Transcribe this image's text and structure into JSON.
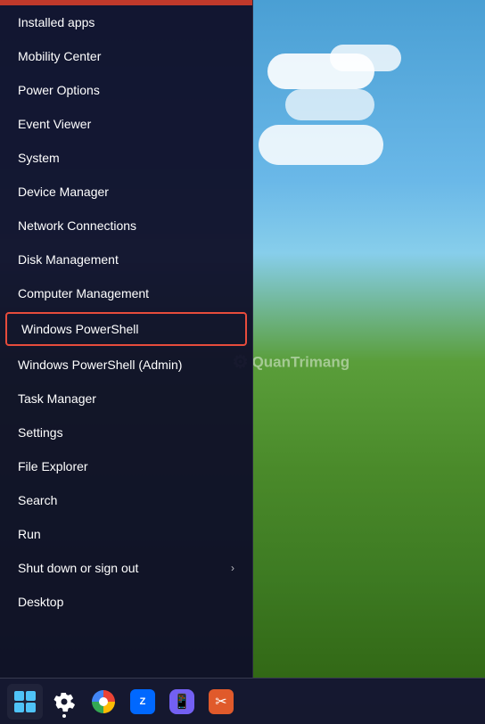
{
  "desktop": {
    "watermark": "QuanTrimang"
  },
  "menu": {
    "items": [
      {
        "id": "installed-apps",
        "label": "Installed apps",
        "hasChevron": false,
        "highlighted": false
      },
      {
        "id": "mobility-center",
        "label": "Mobility Center",
        "hasChevron": false,
        "highlighted": false
      },
      {
        "id": "power-options",
        "label": "Power Options",
        "hasChevron": false,
        "highlighted": false
      },
      {
        "id": "event-viewer",
        "label": "Event Viewer",
        "hasChevron": false,
        "highlighted": false
      },
      {
        "id": "system",
        "label": "System",
        "hasChevron": false,
        "highlighted": false
      },
      {
        "id": "device-manager",
        "label": "Device Manager",
        "hasChevron": false,
        "highlighted": false
      },
      {
        "id": "network-connections",
        "label": "Network Connections",
        "hasChevron": false,
        "highlighted": false
      },
      {
        "id": "disk-management",
        "label": "Disk Management",
        "hasChevron": false,
        "highlighted": false
      },
      {
        "id": "computer-management",
        "label": "Computer Management",
        "hasChevron": false,
        "highlighted": false
      },
      {
        "id": "windows-powershell",
        "label": "Windows PowerShell",
        "hasChevron": false,
        "highlighted": true
      },
      {
        "id": "windows-powershell-admin",
        "label": "Windows PowerShell (Admin)",
        "hasChevron": false,
        "highlighted": false
      },
      {
        "id": "task-manager",
        "label": "Task Manager",
        "hasChevron": false,
        "highlighted": false
      },
      {
        "id": "settings",
        "label": "Settings",
        "hasChevron": false,
        "highlighted": false
      },
      {
        "id": "file-explorer",
        "label": "File Explorer",
        "hasChevron": false,
        "highlighted": false
      },
      {
        "id": "search",
        "label": "Search",
        "hasChevron": false,
        "highlighted": false
      },
      {
        "id": "run",
        "label": "Run",
        "hasChevron": false,
        "highlighted": false
      },
      {
        "id": "shut-down",
        "label": "Shut down or sign out",
        "hasChevron": true,
        "highlighted": false
      },
      {
        "id": "desktop",
        "label": "Desktop",
        "hasChevron": false,
        "highlighted": false
      }
    ]
  },
  "taskbar": {
    "icons": [
      {
        "id": "start",
        "type": "start",
        "label": "Start"
      },
      {
        "id": "gear",
        "type": "gear",
        "label": "Settings"
      },
      {
        "id": "chrome",
        "type": "chrome",
        "label": "Google Chrome"
      },
      {
        "id": "zalo",
        "type": "zalo",
        "label": "Zalo"
      },
      {
        "id": "viber",
        "type": "viber",
        "label": "Viber"
      },
      {
        "id": "scissors",
        "type": "scissors",
        "label": "Snipping Tool"
      }
    ]
  }
}
